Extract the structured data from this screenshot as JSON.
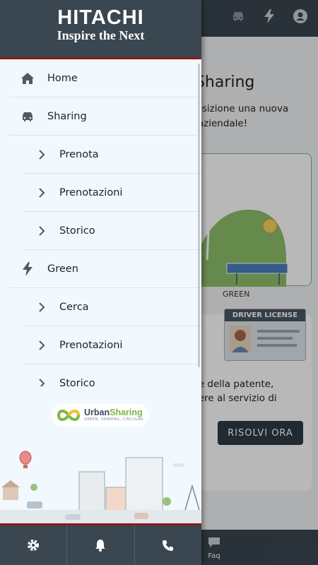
{
  "app": {
    "title": "UrbanSharing",
    "title_visible": "nSharing",
    "subtitle_visible": "sposizione una nuova\ntà aziendale!",
    "green_card_label": "GREEN",
    "license_badge": "DRIVER LICENSE",
    "license_text_visible": "one della patente,\nedere al servizio di",
    "resolve_button": "RISOLVI ORA",
    "faq_label": "Faq",
    "topbar_icons": [
      "car-icon",
      "lightning-icon",
      "account-icon"
    ]
  },
  "drawer": {
    "brand": "HITACHI",
    "tagline": "Inspire the Next",
    "menu": [
      {
        "label": "Home",
        "icon": "home-icon",
        "level": 0
      },
      {
        "label": "Sharing",
        "icon": "car-icon",
        "level": 0
      },
      {
        "label": "Prenota",
        "icon": "chevron-right-icon",
        "level": 1
      },
      {
        "label": "Prenotazioni",
        "icon": "chevron-right-icon",
        "level": 1
      },
      {
        "label": "Storico",
        "icon": "chevron-right-icon",
        "level": 1
      },
      {
        "label": "Green",
        "icon": "lightning-icon",
        "level": 0
      },
      {
        "label": "Cerca",
        "icon": "chevron-right-icon",
        "level": 1
      },
      {
        "label": "Prenotazioni",
        "icon": "chevron-right-icon",
        "level": 1
      },
      {
        "label": "Storico",
        "icon": "chevron-right-icon",
        "level": 1
      }
    ],
    "logo": {
      "name_a": "Urban",
      "name_b": "Sharing",
      "sub": "GREEN, SHARING, CIRCULAR"
    },
    "bottom_icons": [
      "gear-icon",
      "bell-icon",
      "phone-icon"
    ]
  },
  "colors": {
    "header": "#3a4650",
    "accent_red": "#8b1a1a",
    "drawer_bg": "#f1f8fe",
    "green": "#7ab648"
  }
}
